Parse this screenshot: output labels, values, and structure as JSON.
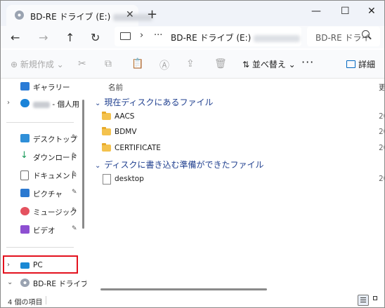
{
  "window": {
    "tab_title": "BD-RE ドライブ (E:)",
    "tab_close": "✕",
    "new_tab": "+",
    "minimize": "—",
    "maximize": "☐",
    "close": "✕"
  },
  "address": {
    "location": "BD-RE ドライブ (E:)",
    "chevron": "›",
    "ellipsis": "···",
    "search_placeholder": "BD-RE ドライ"
  },
  "commands": {
    "new_label": "⊕ 新規作成 ⌄",
    "sort_label": "⇅ 並べ替え ⌄",
    "more_label": "···",
    "details_label": "詳細"
  },
  "sidebar": {
    "items": [
      {
        "label": "ギャラリー",
        "icon": "gallery-icon",
        "color": "#2a7bd6"
      },
      {
        "label": "- 個人用",
        "icon": "onedrive-icon",
        "color": "#1a83d8"
      },
      {
        "label": "デスクトップ",
        "icon": "desktop-icon",
        "color": "#2f8fd8"
      },
      {
        "label": "ダウンロード",
        "icon": "download-icon",
        "color": "#1a9a5a"
      },
      {
        "label": "ドキュメント",
        "icon": "documents-icon",
        "color": "#6d6d6d"
      },
      {
        "label": "ピクチャ",
        "icon": "pictures-icon",
        "color": "#2b79d0"
      },
      {
        "label": "ミュージック",
        "icon": "music-icon",
        "color": "#e4525f"
      },
      {
        "label": "ビデオ",
        "icon": "videos-icon",
        "color": "#8d4fd1"
      },
      {
        "label": "PC",
        "icon": "pc-icon",
        "color": "#1b89d4"
      },
      {
        "label": "BD-RE ドライブ (E",
        "icon": "disc-drive-icon",
        "color": "#9aa3b1"
      }
    ],
    "pin_glyph": "📌"
  },
  "columns": {
    "name": "名前",
    "date": "更"
  },
  "groups": [
    {
      "label": "現在ディスクにあるファイル",
      "files": [
        {
          "name": "AACS",
          "date": "20"
        },
        {
          "name": "BDMV",
          "date": "20"
        },
        {
          "name": "CERTIFICATE",
          "date": "20"
        }
      ]
    },
    {
      "label": "ディスクに書き込む準備ができたファイル",
      "files": [
        {
          "name": "desktop",
          "date": "20"
        }
      ]
    }
  ],
  "status": {
    "item_count": "4 個の項目"
  }
}
